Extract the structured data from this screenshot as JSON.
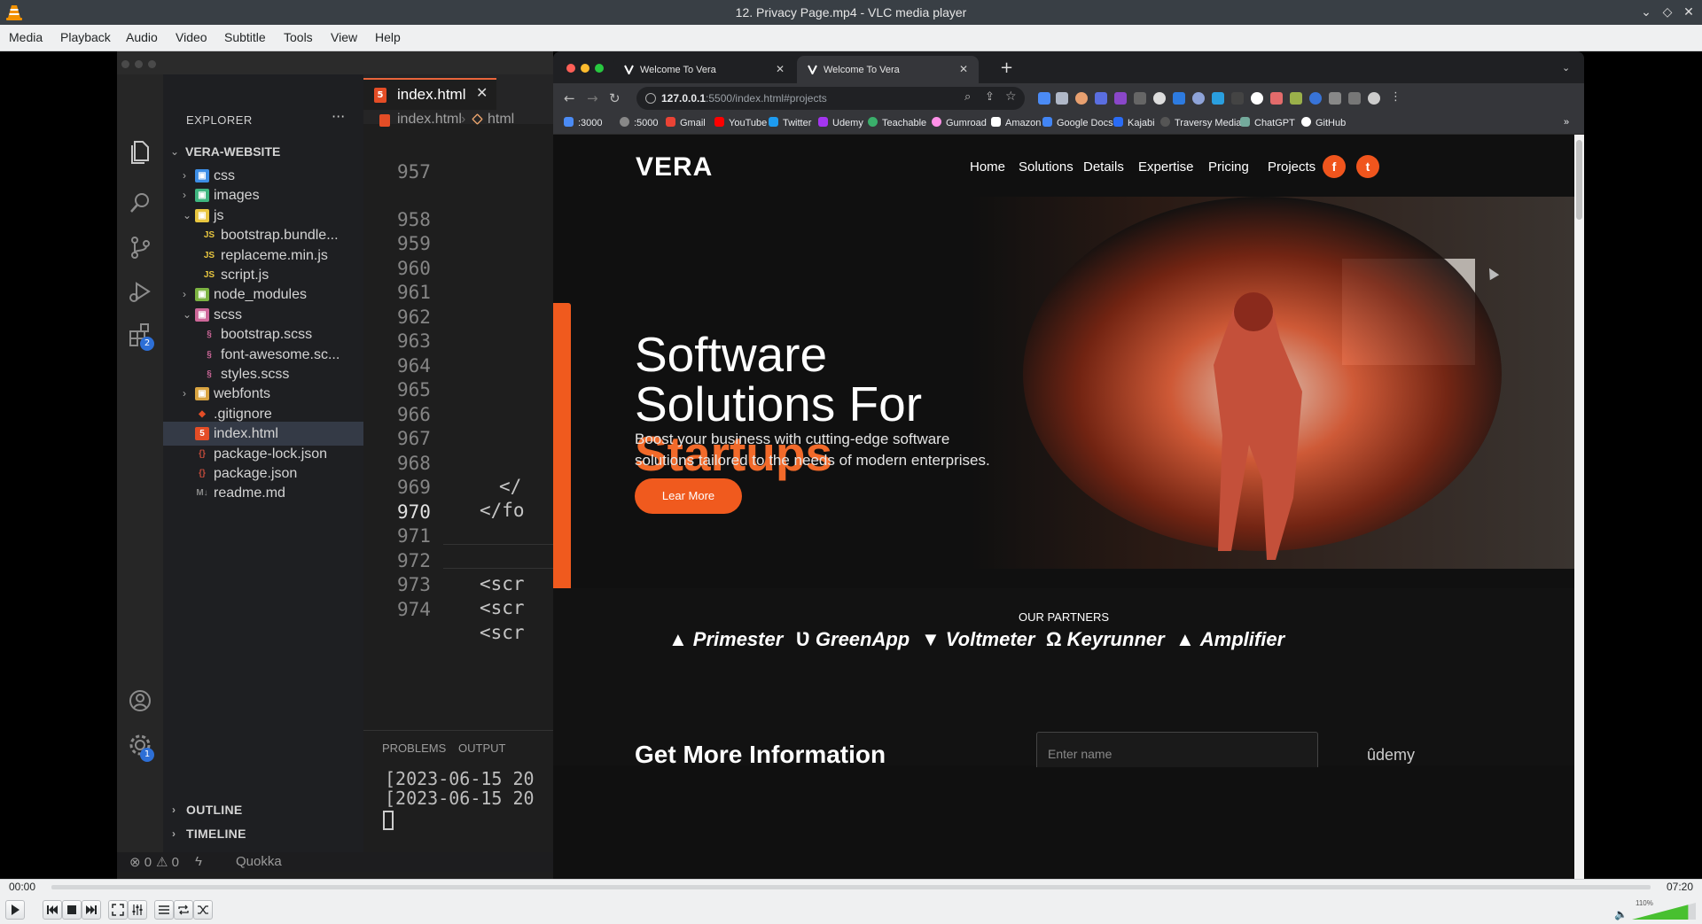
{
  "window": {
    "title": "12. Privacy Page.mp4 - VLC media player"
  },
  "menubar": [
    "Media",
    "Playback",
    "Audio",
    "Video",
    "Subtitle",
    "Tools",
    "View",
    "Help"
  ],
  "player": {
    "elapsed": "00:00",
    "duration": "07:20",
    "progress": 0.0,
    "volume_label": "110%",
    "volume_fraction": 0.88
  },
  "vscode": {
    "explorer_title": "EXPLORER",
    "project": "VERA-WEBSITE",
    "tree": [
      {
        "label": "css",
        "type": "folder-css"
      },
      {
        "label": "images",
        "type": "folder-img"
      },
      {
        "label": "js",
        "type": "folder-js"
      },
      {
        "label": "bootstrap.bundle...",
        "type": "js"
      },
      {
        "label": "replaceme.min.js",
        "type": "js"
      },
      {
        "label": "script.js",
        "type": "js"
      },
      {
        "label": "node_modules",
        "type": "folder-node"
      },
      {
        "label": "scss",
        "type": "folder-scss"
      },
      {
        "label": "bootstrap.scss",
        "type": "scss"
      },
      {
        "label": "font-awesome.sc...",
        "type": "scss"
      },
      {
        "label": "styles.scss",
        "type": "scss"
      },
      {
        "label": "webfonts",
        "type": "folder"
      },
      {
        "label": ".gitignore",
        "type": "git"
      },
      {
        "label": "index.html",
        "type": "html"
      },
      {
        "label": "package-lock.json",
        "type": "json"
      },
      {
        "label": "package.json",
        "type": "json"
      },
      {
        "label": "readme.md",
        "type": "md"
      }
    ],
    "outline": "OUTLINE",
    "timeline": "TIMELINE",
    "tab_label": "index.html",
    "breadcrumb": [
      "index.html",
      "html"
    ],
    "line_numbers": [
      "957",
      "958",
      "959",
      "960",
      "961",
      "962",
      "963",
      "964",
      "965",
      "966",
      "967",
      "968",
      "969",
      "970",
      "971",
      "972",
      "973",
      "974"
    ],
    "code": {
      "l968": "</",
      "l969": "</fo",
      "l972": "<scr",
      "l973": "<scr",
      "l974": "<scr"
    },
    "panel_tabs": [
      "PROBLEMS",
      "OUTPUT"
    ],
    "terminal": [
      "[2023-06-15 20",
      "[2023-06-15 20"
    ],
    "status": {
      "errors": "0",
      "warnings": "0",
      "extension": "Quokka"
    },
    "badges": {
      "extensions": "2",
      "settings": "1"
    }
  },
  "browser": {
    "tabs": [
      {
        "title": "Welcome To Vera"
      },
      {
        "title": "Welcome To Vera"
      }
    ],
    "url_host": "127.0.0.1",
    "url_rest": ":5500/index.html#projects",
    "bookmarks": [
      ":3000",
      ":5000",
      "Gmail",
      "YouTube",
      "Twitter",
      "Udemy",
      "Teachable",
      "Gumroad",
      "Amazon",
      "Google Docs",
      "Kajabi",
      "Traversy Media",
      "ChatGPT",
      "GitHub"
    ]
  },
  "site": {
    "logo": "VERA",
    "nav": [
      "Home",
      "Solutions",
      "Details",
      "Expertise",
      "Pricing",
      "Projects"
    ],
    "social": [
      "f",
      "t"
    ],
    "hero": {
      "line1": "Software",
      "line2": "Solutions For",
      "line3": "Startups",
      "sub1": "Boost your business with cutting-edge software",
      "sub2": "solutions tailored to the needs of modern enterprises.",
      "cta": "Lear More"
    },
    "partners_heading": "OUR PARTNERS",
    "partners": [
      "Primester",
      "GreenApp",
      "Voltmeter",
      "Keyrunner",
      "Amplifier"
    ],
    "more_info": "Get More Information",
    "name_placeholder": "Enter name",
    "watermark": "ûdemy"
  },
  "colors": {
    "accent": "#f05a1e",
    "vlc_bar": "#eff0f1",
    "vscode_bg": "#1e1e1e"
  }
}
